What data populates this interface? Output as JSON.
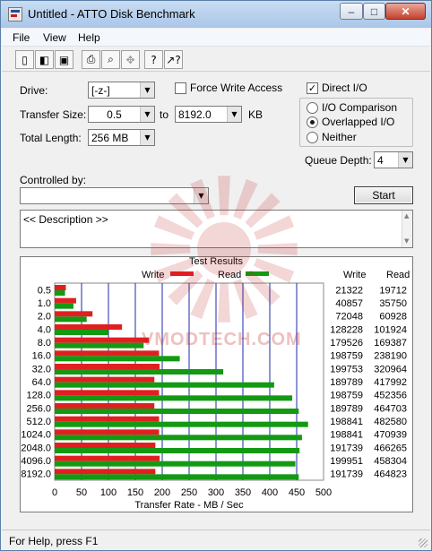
{
  "window": {
    "title": "Untitled - ATTO Disk Benchmark",
    "min_glyph": "–",
    "max_glyph": "□",
    "close_glyph": "✕"
  },
  "menu": [
    "File",
    "View",
    "Help"
  ],
  "toolbar": {
    "icons": [
      "new-icon",
      "open-icon",
      "save-icon",
      "print-icon",
      "print-preview-icon",
      "move-icon",
      "help-icon",
      "context-help-icon"
    ],
    "glyphs": [
      "▯",
      "◧",
      "▣",
      "⎙",
      "⌕",
      "✥",
      "?",
      "↗?"
    ]
  },
  "form": {
    "drive_label": "Drive:",
    "drive_value": "[-z-]",
    "force_write_label": "Force Write Access",
    "force_write_checked": false,
    "direct_io_label": "Direct I/O",
    "direct_io_checked": true,
    "direct_io_mark": "✓",
    "transfer_size_label": "Transfer Size:",
    "transfer_from": "0.5",
    "to_label": "to",
    "transfer_to": "8192.0",
    "kb_label": "KB",
    "total_length_label": "Total Length:",
    "total_length": "256 MB",
    "io_comparison_label": "I/O Comparison",
    "overlapped_io_label": "Overlapped I/O",
    "neither_label": "Neither",
    "selected_mode": "Overlapped I/O",
    "queue_depth_label": "Queue Depth:",
    "queue_depth": "4",
    "controlled_by_label": "Controlled by:",
    "controlled_by_value": "",
    "start_label": "Start",
    "description": "<< Description >>",
    "dropdown_arrow": "▼",
    "scroll_up": "▲",
    "scroll_down": "▼"
  },
  "status": {
    "text": "For Help, press F1"
  },
  "watermark": "VMODTECH.COM",
  "colors": {
    "write": "#e02020",
    "read": "#129a12",
    "grid": "#1a2aa8"
  },
  "chart_data": {
    "type": "bar",
    "title": "Test Results",
    "legend": [
      "Write",
      "Read"
    ],
    "legend_placement": "top",
    "xlabel": "Transfer Rate - MB / Sec",
    "xlim": [
      0,
      500
    ],
    "xticks": [
      0,
      50,
      100,
      150,
      200,
      250,
      300,
      350,
      400,
      450,
      500
    ],
    "grid": true,
    "categories": [
      "0.5",
      "1.0",
      "2.0",
      "4.0",
      "8.0",
      "16.0",
      "32.0",
      "64.0",
      "128.0",
      "256.0",
      "512.0",
      "1024.0",
      "2048.0",
      "4096.0",
      "8192.0"
    ],
    "columns": [
      "Write",
      "Read"
    ],
    "series": [
      {
        "name": "Write",
        "values_kb": [
          21322,
          40857,
          72048,
          128228,
          179526,
          198759,
          199753,
          189789,
          198759,
          189789,
          198841,
          198841,
          191739,
          199951,
          191739
        ]
      },
      {
        "name": "Read",
        "values_kb": [
          19712,
          35750,
          60928,
          101924,
          169387,
          238190,
          320964,
          417992,
          452356,
          464703,
          482580,
          470939,
          466265,
          458304,
          464823
        ]
      }
    ]
  }
}
